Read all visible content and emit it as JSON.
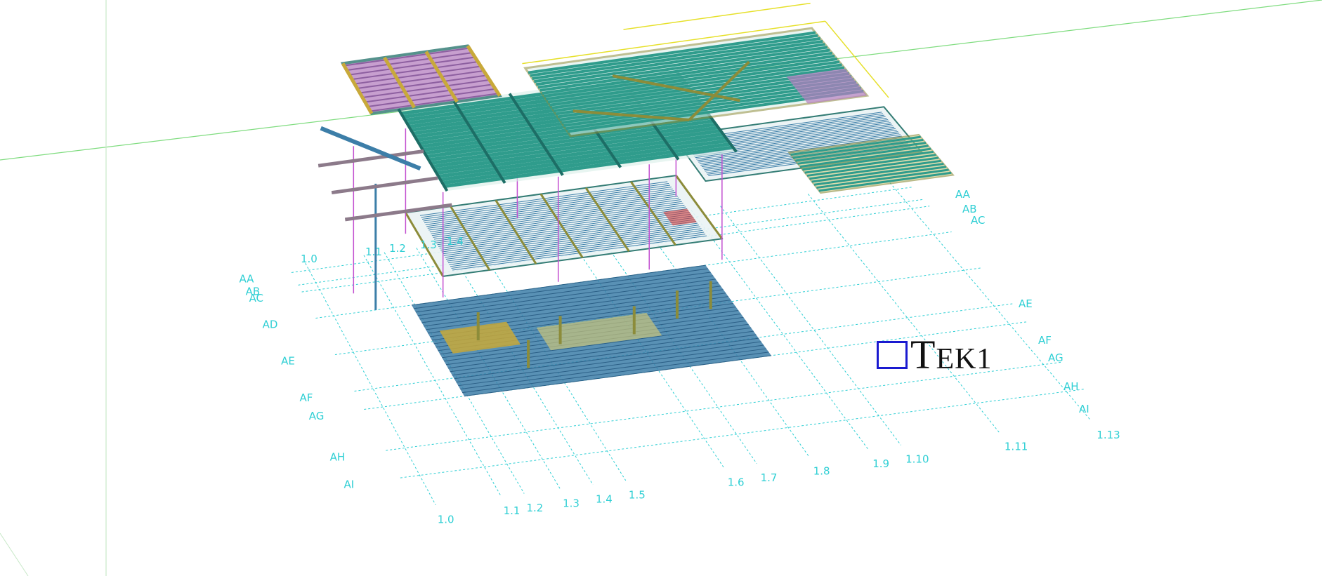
{
  "colors": {
    "background": "#ffffff",
    "grid": "#2fcfd4",
    "beam": "#2f9c8c",
    "beam_dark": "#1d6e66",
    "secondary": "#8c8c3a",
    "yellow": "#e6e02a",
    "purple": "#b57fc0",
    "column": "#c24fd0",
    "slab": "#3c7ea8",
    "slab_light": "#5a9bc6",
    "red": "#d24040",
    "horizon": "#7fdc7f",
    "watermark_box": "#1a1ad0"
  },
  "grid": {
    "numeric_front": [
      "1.0",
      "1.1",
      "1.2",
      "1.3",
      "1.4",
      "1.5",
      "1.6",
      "1.7",
      "1.8",
      "1.9",
      "1.10",
      "1.11",
      "1.13"
    ],
    "numeric_back": [
      "1.0",
      "1.1",
      "1.2",
      "1.3",
      "1.4"
    ],
    "letter_left": [
      "AA",
      "AB",
      "AC",
      "AD",
      "AE",
      "AF",
      "AG",
      "AH",
      "AI"
    ],
    "letter_right": [
      "AA",
      "AB",
      "AC",
      "AE",
      "AF",
      "AG",
      "AH",
      "AI"
    ]
  },
  "watermark": {
    "icon": "square-outline-icon",
    "first": "T",
    "rest": "EK1"
  }
}
